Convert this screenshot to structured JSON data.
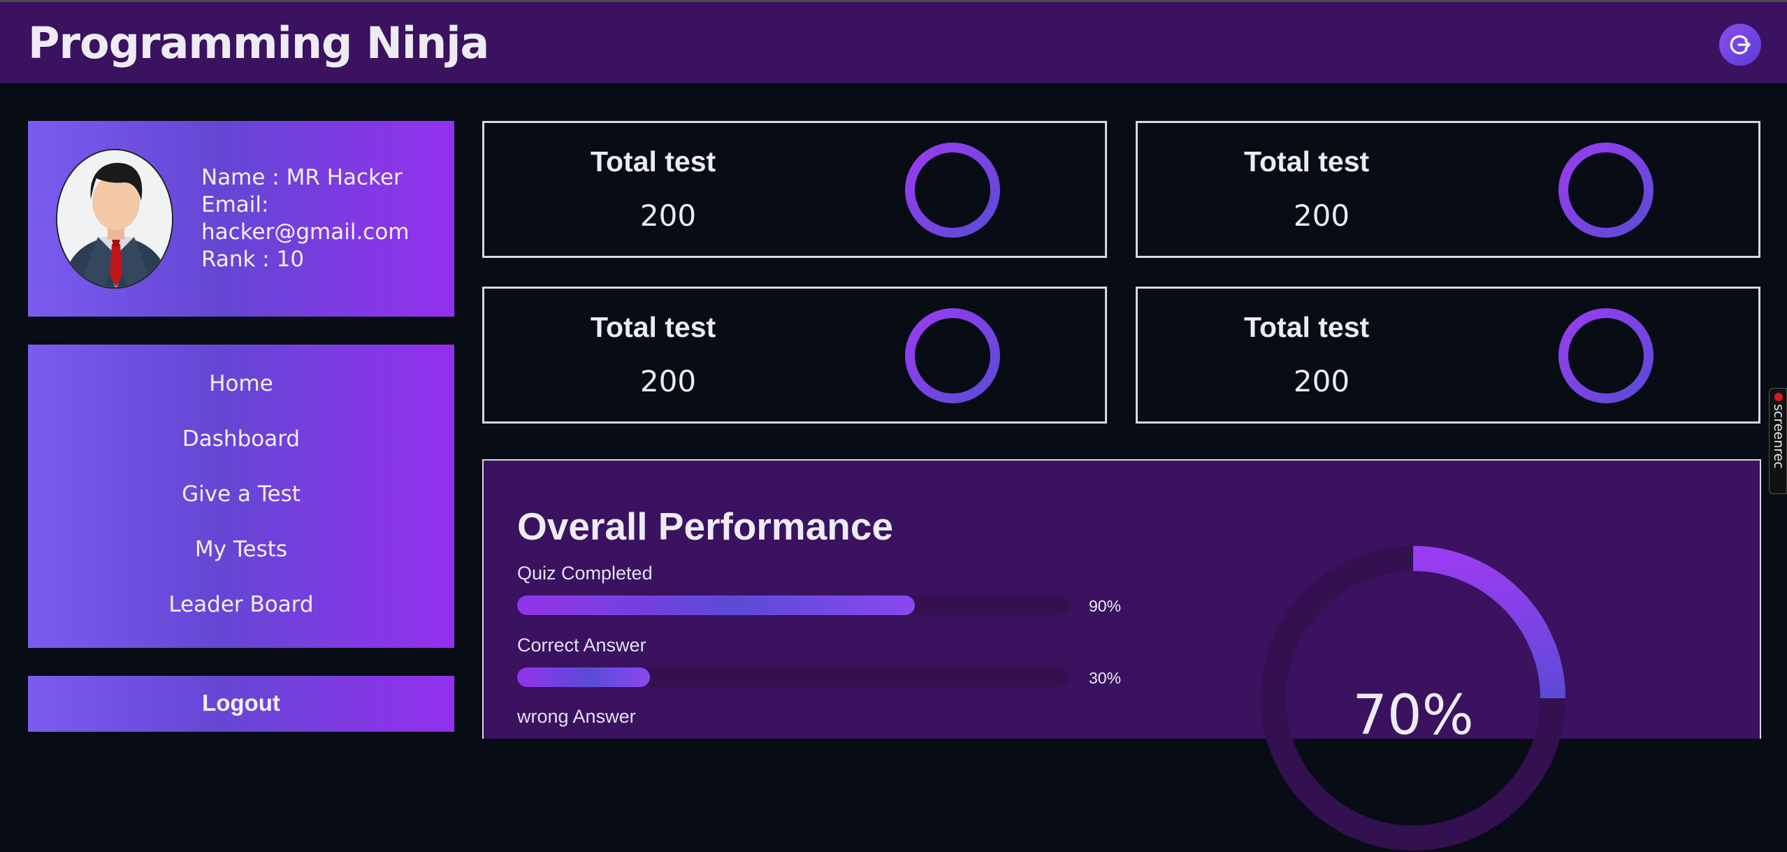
{
  "header": {
    "title": "Programming Ninja",
    "action_icon": "logout-arrow-icon"
  },
  "profile": {
    "name_line": "Name : MR Hacker",
    "email_label": "Email:",
    "email_value": "hacker@gmail.com",
    "rank_line": "Rank : 10",
    "avatar_icon": "businessman-avatar-icon"
  },
  "nav": {
    "items": [
      {
        "label": "Home"
      },
      {
        "label": "Dashboard"
      },
      {
        "label": "Give a Test"
      },
      {
        "label": "My Tests"
      },
      {
        "label": "Leader Board"
      }
    ]
  },
  "logout": {
    "label": "Logout"
  },
  "stats": [
    {
      "label": "Total test",
      "value": "200"
    },
    {
      "label": "Total test",
      "value": "200"
    },
    {
      "label": "Total test",
      "value": "200"
    },
    {
      "label": "Total test",
      "value": "200"
    }
  ],
  "performance": {
    "title": "Overall Performance",
    "metrics": [
      {
        "label": "Quiz Completed",
        "percent_text": "90%",
        "value": 90
      },
      {
        "label": "Correct Answer",
        "percent_text": "30%",
        "value": 30
      },
      {
        "label": "wrong Answer"
      }
    ],
    "overall_percent_text": "70%",
    "overall_value": 70
  },
  "screenrec": {
    "label": "screenrec"
  },
  "colors": {
    "header_bg": "#3a1260",
    "page_bg": "#070c15",
    "accent_purple": "#9333ea",
    "accent_indigo": "#5b4bd6"
  }
}
